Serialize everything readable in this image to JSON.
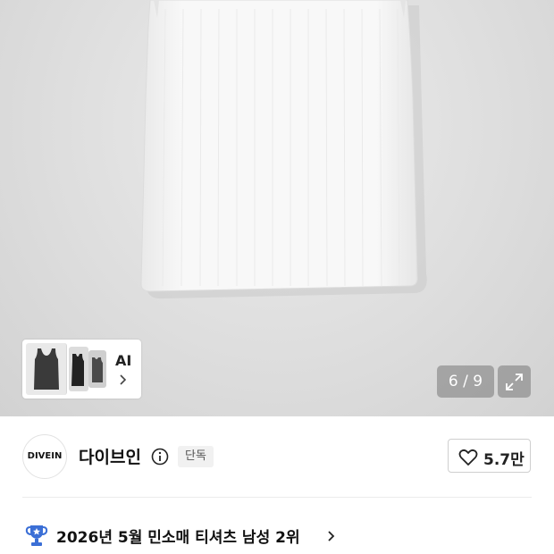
{
  "gallery": {
    "current": 6,
    "total": 9,
    "counter_text": "6 / 9",
    "background_color": "#dedede",
    "garment_color": "#f7f7f7"
  },
  "ai_similar": {
    "label": "AI",
    "thumbnail_colors": [
      "#3a3a3a",
      "#222222",
      "#4a4a4a"
    ]
  },
  "brand": {
    "logo_text": "DIVEIN",
    "name": "다이브인",
    "badge": "단독"
  },
  "likes": {
    "count": "5.7만"
  },
  "ranking": {
    "text": "2026년 5월 민소매 티셔츠 남성 2위",
    "icon_color": "#3b6fd6"
  }
}
